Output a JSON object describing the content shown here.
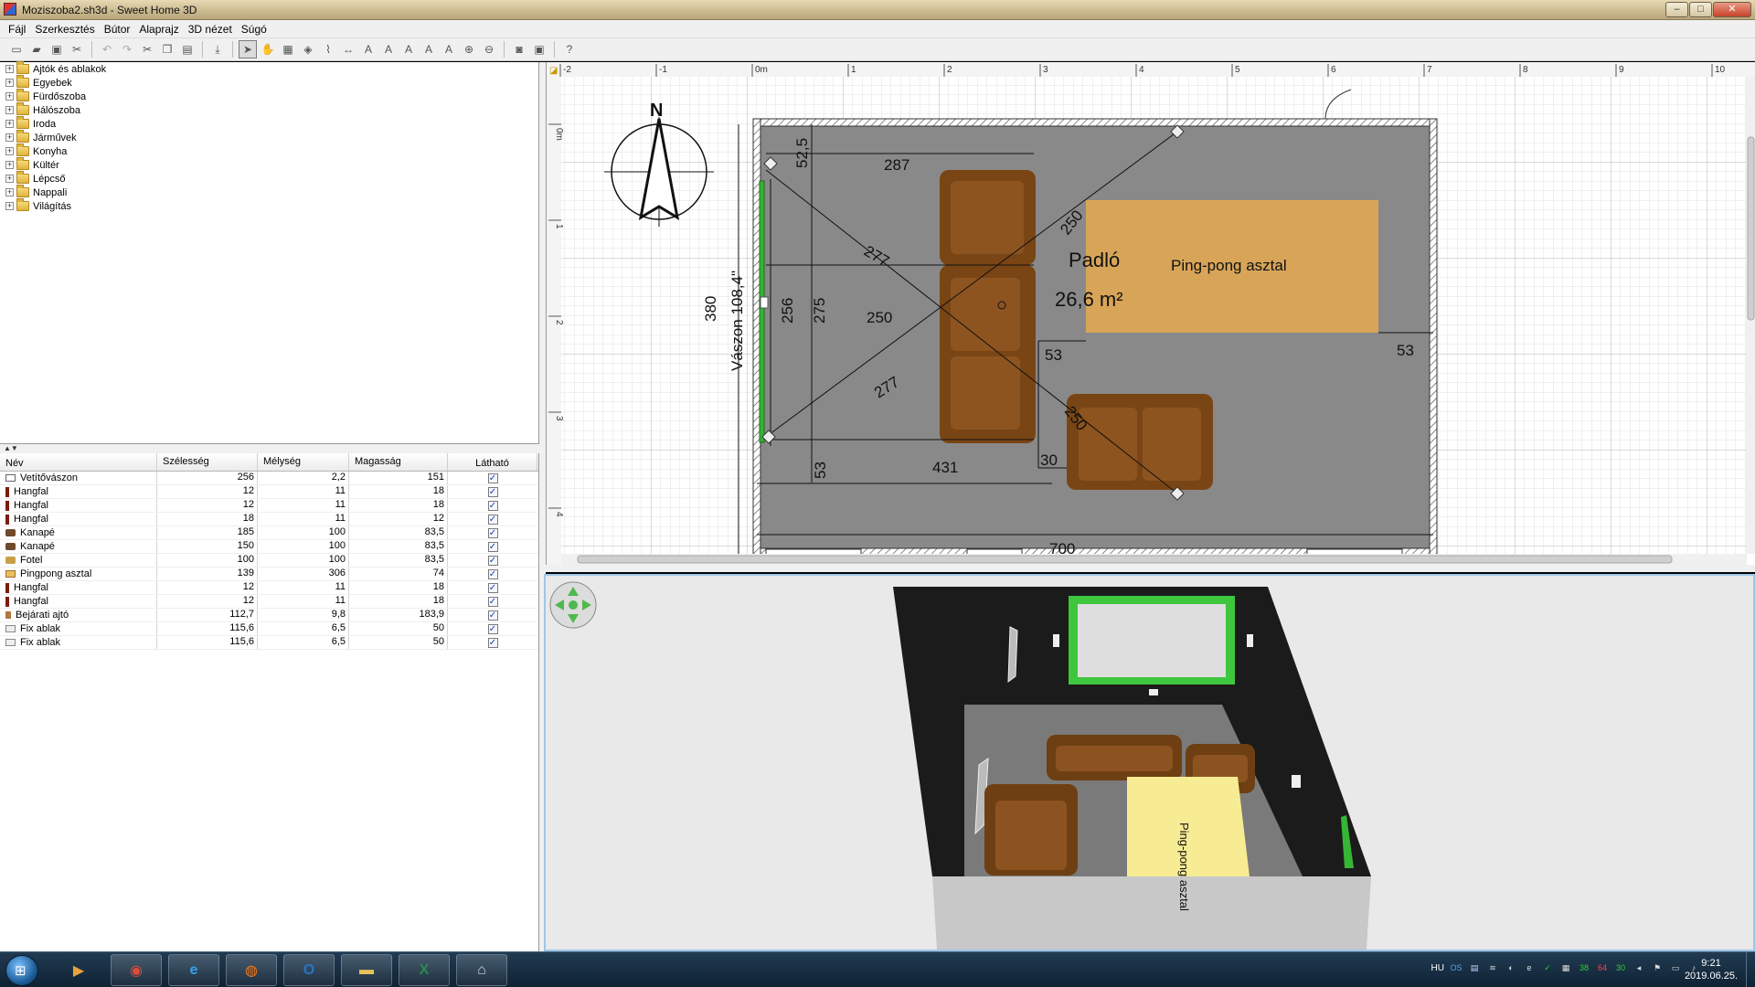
{
  "window": {
    "title": "Moziszoba2.sh3d - Sweet Home 3D",
    "controls": [
      "–",
      "□",
      "✕"
    ]
  },
  "menu": [
    "Fájl",
    "Szerkesztés",
    "Bútor",
    "Alaprajz",
    "3D nézet",
    "Súgó"
  ],
  "toolbar": [
    {
      "icon": "new-icon",
      "glyph": "▭"
    },
    {
      "icon": "open-icon",
      "glyph": "▰"
    },
    {
      "icon": "save-icon",
      "glyph": "▣"
    },
    {
      "icon": "cut-x-icon",
      "glyph": "✂"
    },
    {
      "sep": true
    },
    {
      "icon": "undo-icon",
      "glyph": "↶",
      "disabled": true
    },
    {
      "icon": "redo-icon",
      "glyph": "↷",
      "disabled": true
    },
    {
      "icon": "cut-icon",
      "glyph": "✂"
    },
    {
      "icon": "copy-icon",
      "glyph": "❐"
    },
    {
      "icon": "paste-icon",
      "glyph": "▤"
    },
    {
      "sep": true
    },
    {
      "icon": "add-furniture-icon",
      "glyph": "⤓"
    },
    {
      "sep": true
    },
    {
      "icon": "select-mode-icon",
      "glyph": "➤",
      "active": true
    },
    {
      "icon": "pan-mode-icon",
      "glyph": "✋"
    },
    {
      "icon": "create-walls-icon",
      "glyph": "▦"
    },
    {
      "icon": "create-rooms-icon",
      "glyph": "◈"
    },
    {
      "icon": "create-polylines-icon",
      "glyph": "⌇"
    },
    {
      "icon": "create-dimensions-icon",
      "glyph": "↔"
    },
    {
      "icon": "create-labels-icon",
      "glyph": "A"
    },
    {
      "icon": "increase-text-icon",
      "glyph": "A"
    },
    {
      "icon": "decrease-text-icon",
      "glyph": "A"
    },
    {
      "icon": "bold-text-icon",
      "glyph": "A"
    },
    {
      "icon": "italic-text-icon",
      "glyph": "A"
    },
    {
      "icon": "zoom-in-icon",
      "glyph": "⊕"
    },
    {
      "icon": "zoom-out-icon",
      "glyph": "⊖"
    },
    {
      "sep": true
    },
    {
      "icon": "create-photo-icon",
      "glyph": "◙"
    },
    {
      "icon": "create-video-icon",
      "glyph": "▣"
    },
    {
      "sep": true
    },
    {
      "icon": "help-icon",
      "glyph": "?"
    }
  ],
  "catalog": [
    "Ajtók és ablakok",
    "Egyebek",
    "Fürdőszoba",
    "Hálószoba",
    "Iroda",
    "Járművek",
    "Konyha",
    "Kültér",
    "Lépcső",
    "Nappali",
    "Világítás"
  ],
  "furniture": {
    "columns": [
      "Név",
      "Szélesség",
      "Mélység",
      "Magasság",
      "Látható"
    ],
    "rows": [
      {
        "name": "Vetítővászon",
        "w": "256",
        "d": "2,2",
        "h": "151",
        "icon": "screen",
        "visible": "✓"
      },
      {
        "name": "Hangfal",
        "w": "12",
        "d": "11",
        "h": "18",
        "icon": "speaker",
        "visible": "✓"
      },
      {
        "name": "Hangfal",
        "w": "12",
        "d": "11",
        "h": "18",
        "icon": "speaker",
        "visible": "✓"
      },
      {
        "name": "Hangfal",
        "w": "18",
        "d": "11",
        "h": "12",
        "icon": "speaker",
        "visible": "✓"
      },
      {
        "name": "Kanapé",
        "w": "185",
        "d": "100",
        "h": "83,5",
        "icon": "sofa",
        "visible": "✓"
      },
      {
        "name": "Kanapé",
        "w": "150",
        "d": "100",
        "h": "83,5",
        "icon": "sofa",
        "visible": "✓"
      },
      {
        "name": "Fotel",
        "w": "100",
        "d": "100",
        "h": "83,5",
        "icon": "armchair",
        "visible": "✓"
      },
      {
        "name": "Pingpong asztal",
        "w": "139",
        "d": "306",
        "h": "74",
        "icon": "table",
        "visible": "✓"
      },
      {
        "name": "Hangfal",
        "w": "12",
        "d": "11",
        "h": "18",
        "icon": "speaker",
        "visible": "✓"
      },
      {
        "name": "Hangfal",
        "w": "12",
        "d": "11",
        "h": "18",
        "icon": "speaker",
        "visible": "✓"
      },
      {
        "name": "Bejárati ajtó",
        "w": "112,7",
        "d": "9,8",
        "h": "183,9",
        "icon": "door",
        "visible": "✓"
      },
      {
        "name": "Fix ablak",
        "w": "115,6",
        "d": "6,5",
        "h": "50",
        "icon": "window",
        "visible": "✓"
      },
      {
        "name": "Fix ablak",
        "w": "115,6",
        "d": "6,5",
        "h": "50",
        "icon": "window",
        "visible": "✓"
      }
    ]
  },
  "plan": {
    "ruler_x": [
      "-2",
      "-1",
      "0m",
      "1",
      "2",
      "3",
      "4",
      "5",
      "6",
      "7",
      "8",
      "9",
      "10"
    ],
    "ruler_y": [
      "0m",
      "1",
      "2",
      "3",
      "4"
    ],
    "compass_label": "N",
    "room_name": "Padló",
    "room_area": "26,6 m²",
    "table_label": "Ping-pong asztal",
    "screen_label": "Vászon 108,4\"",
    "dims": {
      "d287": "287",
      "d525": "52,5",
      "d277a": "277",
      "d277b": "277",
      "d250a": "250",
      "d250b": "250",
      "d250c": "250",
      "d256": "256",
      "d275": "275",
      "d380": "380",
      "d53a": "53",
      "d53b": "53",
      "d53c": "53",
      "d431": "431",
      "d30": "30",
      "d700": "700"
    }
  },
  "view3d": {
    "table_label": "Ping-pong asztal"
  },
  "taskbar": {
    "apps": [
      {
        "id": "media-player",
        "glyph": "▶",
        "color": "#e8a33a"
      },
      {
        "id": "chrome",
        "glyph": "◉",
        "color": "#e04b3a"
      },
      {
        "id": "internet-explorer",
        "glyph": "e",
        "color": "#3aa0e8"
      },
      {
        "id": "firefox",
        "glyph": "◍",
        "color": "#f07a1a"
      },
      {
        "id": "outlook",
        "glyph": "O",
        "color": "#2a74c8"
      },
      {
        "id": "explorer",
        "glyph": "▬",
        "color": "#e8c35a"
      },
      {
        "id": "excel",
        "glyph": "X",
        "color": "#2a8a4a"
      },
      {
        "id": "sweet-home-3d",
        "glyph": "⌂",
        "color": "#c8d8f0"
      }
    ],
    "lang": "HU",
    "tray": [
      {
        "id": "tray-outlook-icon",
        "t": "OS",
        "c": "#4da3ff"
      },
      {
        "id": "tray-doc-icon",
        "t": "▤",
        "c": "#c8d8ff"
      },
      {
        "id": "tray-network-icon",
        "t": "≋",
        "c": "#d0d0d0"
      },
      {
        "id": "tray-app-icon",
        "t": "◐",
        "c": "#ddd"
      },
      {
        "id": "tray-e-icon",
        "t": "e",
        "c": "#ddd"
      },
      {
        "id": "tray-check-icon",
        "t": "✓",
        "c": "#3c3"
      },
      {
        "id": "tray-monitor-icon",
        "t": "▦",
        "c": "#ddd"
      },
      {
        "id": "tray-temp1-icon",
        "t": "38",
        "c": "#3c3"
      },
      {
        "id": "tray-temp2-icon",
        "t": "64",
        "c": "#f44"
      },
      {
        "id": "tray-temp3-icon",
        "t": "30",
        "c": "#3c3"
      },
      {
        "id": "tray-speaker-icon",
        "t": "◂",
        "c": "#ddd"
      },
      {
        "id": "tray-flag-icon",
        "t": "⚑",
        "c": "#ddd"
      },
      {
        "id": "tray-power-icon",
        "t": "▭",
        "c": "#ddd"
      },
      {
        "id": "tray-volume-icon",
        "t": "♪",
        "c": "#ddd"
      }
    ],
    "time": "9:21",
    "date": "2019.06.25."
  }
}
